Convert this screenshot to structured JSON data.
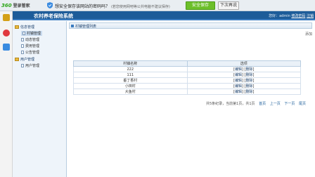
{
  "password_bar": {
    "brand": "360",
    "brand_sub": "登录管家",
    "message": "想安全保存该网站的密码吗？",
    "hint": "(若您使用网吧等公共电脑不建议保存)",
    "save_button": "安全保存",
    "next_button": "下次再说",
    "colors": {
      "save": "#6cbf2a",
      "bar": "#e9eef2"
    }
  },
  "header": {
    "title": "农村养老保险系统",
    "user_prefix": "您好：",
    "username": "admin",
    "change_password": "修改密码",
    "logout": "注销"
  },
  "sidebar": {
    "groups": [
      {
        "label": "信息管理",
        "items": [
          "村镇管理",
          "动态管理",
          "费用管理",
          "公告管理"
        ]
      },
      {
        "label": "用户管理",
        "items": [
          "用户管理"
        ]
      }
    ],
    "active": "村镇管理"
  },
  "main": {
    "panel_title": "村镇管理列表",
    "add_link": "添加",
    "table": {
      "columns": [
        "村镇名称",
        "选项"
      ],
      "rows": [
        {
          "name": "222",
          "edit": "编辑",
          "delete": "删除"
        },
        {
          "name": "111",
          "edit": "编辑",
          "delete": "删除"
        },
        {
          "name": "垂丁香村",
          "edit": "编辑",
          "delete": "删除"
        },
        {
          "name": "小田村",
          "edit": "编辑",
          "delete": "删除"
        },
        {
          "name": "大鱼村",
          "edit": "编辑",
          "delete": "删除"
        }
      ]
    },
    "pager": {
      "summary": "共5条纪录，当前第1页，共1页",
      "first": "首页",
      "prev": "上一页",
      "next": "下一页",
      "last": "尾页"
    }
  }
}
